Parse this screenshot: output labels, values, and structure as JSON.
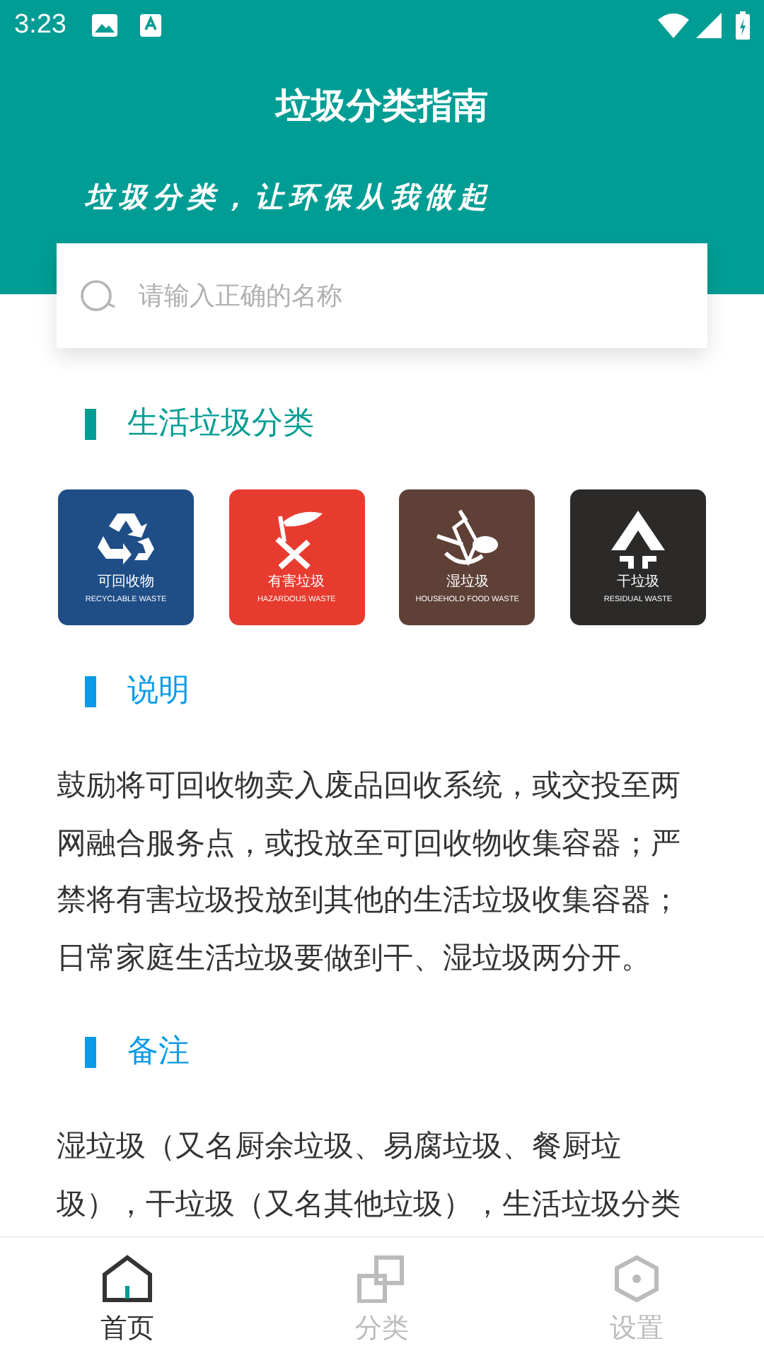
{
  "status_bar": {
    "time": "3:23"
  },
  "header": {
    "title": "垃圾分类指南",
    "slogan": "垃圾分类，让环保从我做起"
  },
  "search": {
    "placeholder": "请输入正确的名称"
  },
  "sections": [
    {
      "kind": "categories",
      "title": "生活垃圾分类",
      "color": "#009d94",
      "categories": [
        {
          "kind": "recyclable",
          "name": "可回收物",
          "english": "RECYCLABLE WASTE",
          "color": "#1f4e87"
        },
        {
          "kind": "hazardous",
          "name": "有害垃圾",
          "english": "HAZARDOUS WASTE",
          "color": "#e83b2f"
        },
        {
          "kind": "food",
          "name": "湿垃圾",
          "english": "HOUSEHOLD FOOD WASTE",
          "color": "#5e4037"
        },
        {
          "kind": "residual",
          "name": "干垃圾",
          "english": "RESIDUAL WASTE",
          "color": "#2b2a29"
        }
      ]
    },
    {
      "kind": "text",
      "title": "说明",
      "color": "#0a9be8",
      "text": "鼓励将可回收物卖入废品回收系统，或交投至两网融合服务点，或投放至可回收物收集容器；严禁将有害垃圾投放到其他的生活垃圾收集容器；日常家庭生活垃圾要做到干、湿垃圾两分开。"
    },
    {
      "kind": "text",
      "title": "备注",
      "color": "#0a9be8",
      "text": "湿垃圾（又名厨余垃圾、易腐垃圾、餐厨垃圾），干垃圾（又名其他垃圾），生活垃圾分类"
    }
  ],
  "nav": [
    {
      "kind": "home",
      "label": "首页",
      "selected": true
    },
    {
      "kind": "category",
      "label": "分类",
      "selected": false
    },
    {
      "kind": "settings",
      "label": "设置",
      "selected": false
    }
  ]
}
